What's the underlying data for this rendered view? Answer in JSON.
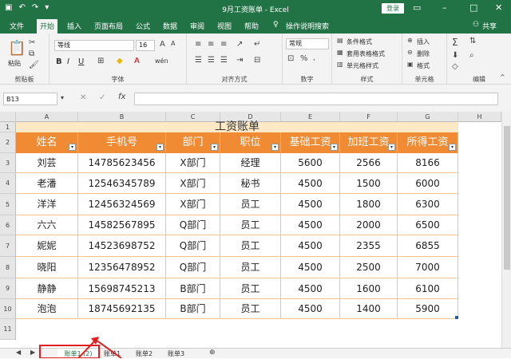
{
  "window": {
    "title": "9月工资账单 - Excel",
    "login": "登录"
  },
  "menu": [
    "文件",
    "开始",
    "插入",
    "页面布局",
    "公式",
    "数据",
    "审阅",
    "视图",
    "帮助",
    "操作说明搜索",
    "共享"
  ],
  "ribbon": {
    "paste": "粘贴",
    "font_name": "等线",
    "font_size": "16",
    "bold": "B",
    "italic": "I",
    "underline": "U",
    "wen": "wén",
    "number_format": "常规",
    "cond_format": "条件格式",
    "table_format": "套用表格格式",
    "cell_style": "单元格样式",
    "insert": "插入",
    "delete": "删除",
    "format": "格式",
    "groups": [
      "剪贴板",
      "字体",
      "对齐方式",
      "数字",
      "样式",
      "单元格",
      "编辑"
    ]
  },
  "formula_bar": {
    "name_box": "B13",
    "fx": "fx",
    "formula": ""
  },
  "columns": [
    "A",
    "B",
    "C",
    "D",
    "E",
    "F",
    "G",
    "H"
  ],
  "rows": [
    "1",
    "2",
    "3",
    "4",
    "5",
    "6",
    "7",
    "8",
    "9",
    "10",
    "11"
  ],
  "sheet": {
    "title": "工资账单",
    "headers": [
      "姓名",
      "手机号",
      "部门",
      "职位",
      "基础工资",
      "加班工资",
      "所得工资"
    ],
    "data": [
      [
        "刘芸",
        "14785623456",
        "X部门",
        "经理",
        "5600",
        "2566",
        "8166"
      ],
      [
        "老潘",
        "12546345789",
        "X部门",
        "秘书",
        "4500",
        "1500",
        "6000"
      ],
      [
        "洋洋",
        "12456324569",
        "X部门",
        "员工",
        "4500",
        "1800",
        "6300"
      ],
      [
        "六六",
        "14582567895",
        "Q部门",
        "员工",
        "4500",
        "2000",
        "6500"
      ],
      [
        "妮妮",
        "14523698752",
        "Q部门",
        "员工",
        "4500",
        "2355",
        "6855"
      ],
      [
        "晓阳",
        "12356478952",
        "Q部门",
        "员工",
        "4500",
        "2500",
        "7000"
      ],
      [
        "静静",
        "15698745213",
        "B部门",
        "员工",
        "4500",
        "1600",
        "6100"
      ],
      [
        "泡泡",
        "18745692135",
        "B部门",
        "员工",
        "4500",
        "1400",
        "5900"
      ]
    ]
  },
  "tabs": [
    "账单1 (2)",
    "账单1",
    "账单2",
    "账单3"
  ],
  "colors": {
    "accent": "#217346",
    "header": "#f08b34",
    "title_fill": "#fde9c6",
    "annotation": "#e02020"
  }
}
